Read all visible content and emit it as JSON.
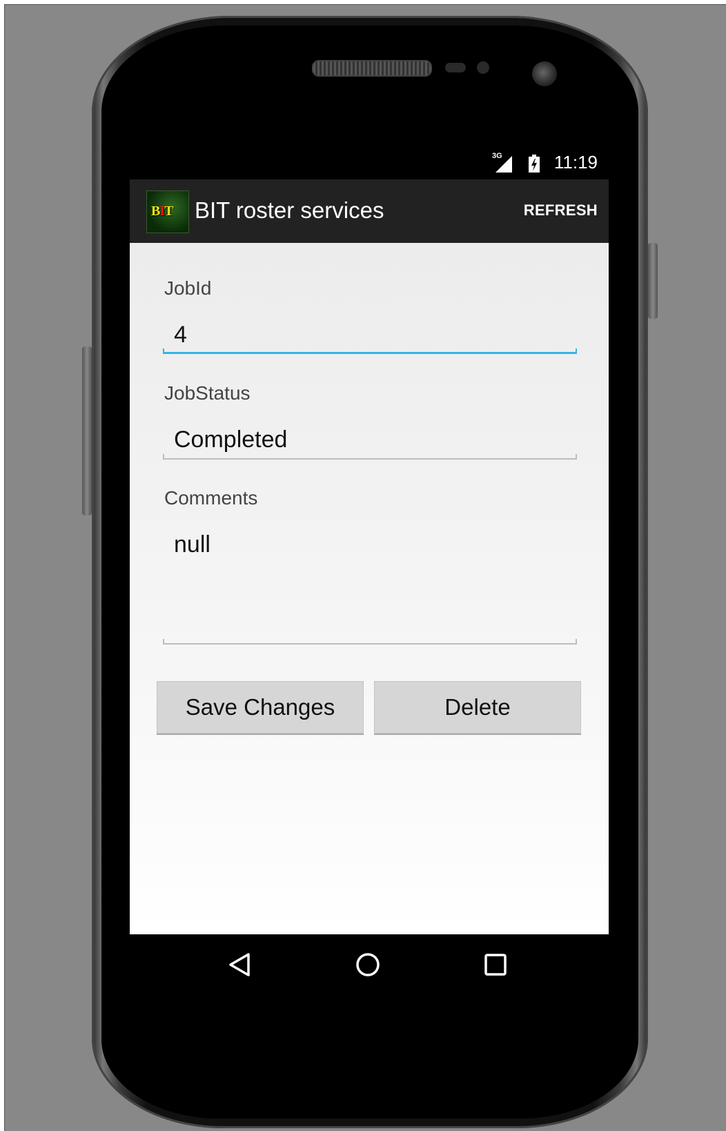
{
  "status_bar": {
    "network": "3G",
    "time": "11:19",
    "icons": [
      "signal-icon",
      "battery-icon"
    ]
  },
  "action_bar": {
    "logo_text": "BIT",
    "title": "BIT roster services",
    "refresh_label": "REFRESH"
  },
  "form": {
    "job_id": {
      "label": "JobId",
      "value": "4"
    },
    "job_status": {
      "label": "JobStatus",
      "value": "Completed"
    },
    "comments": {
      "label": "Comments",
      "value": "null"
    }
  },
  "buttons": {
    "save_label": "Save Changes",
    "delete_label": "Delete"
  },
  "nav_bar": {
    "icons": [
      "back-icon",
      "home-icon",
      "recents-icon"
    ]
  },
  "colors": {
    "action_bar": "#222222",
    "focus_accent": "#33b5e5",
    "button_bg": "#d6d6d6",
    "background_frame": "#888888"
  }
}
